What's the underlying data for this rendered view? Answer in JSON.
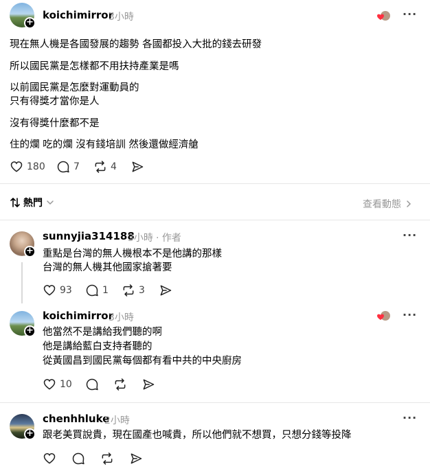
{
  "post": {
    "username": "koichimirror",
    "time": "3小時",
    "lines": [
      "現在無人機是各國發展的趨勢 各國都投入大批的錢去研發",
      "所以國民黨是怎樣都不用扶持產業是嗎",
      "以前國民黨是怎麼對運動員的",
      "只有得獎才當你是人",
      "沒有得獎什麼都不是",
      "住的爛 吃的爛 沒有錢培訓 然後還做經濟艙"
    ],
    "likes": "180",
    "comments": "7",
    "reposts": "4"
  },
  "sort": {
    "label": "熱門",
    "view_activity": "查看動態"
  },
  "reply1": {
    "username": "sunnyjia314188",
    "time": "3小時",
    "author_tag": "· 作者",
    "lines": [
      "重點是台灣的無人機根本不是他講的那樣",
      "台灣的無人機其他國家搶著要"
    ],
    "likes": "93",
    "comments": "1",
    "reposts": "3"
  },
  "reply2": {
    "username": "koichimirror",
    "time": "3小時",
    "lines": [
      "他當然不是講給我們聽的啊",
      "他是講給藍白支持者聽的",
      "從黃國昌到國民黨每個都有看中共的中央廚房"
    ],
    "likes": "10"
  },
  "reply3": {
    "username": "chenhhluke",
    "time": "2小時",
    "lines": [
      "跟老美買說貴，現在國產也喊貴，所以他們就不想買，只想分錢等投降"
    ]
  },
  "icons": {
    "like": "heart-icon",
    "comment": "comment-bubble-icon",
    "repost": "repost-icon",
    "share": "send-icon",
    "more": "more-dots-icon",
    "sort": "sort-arrows-icon",
    "chevron": "chevron-icon"
  },
  "colors": {
    "like_heart": "#ff3040",
    "muted": "#999999"
  }
}
